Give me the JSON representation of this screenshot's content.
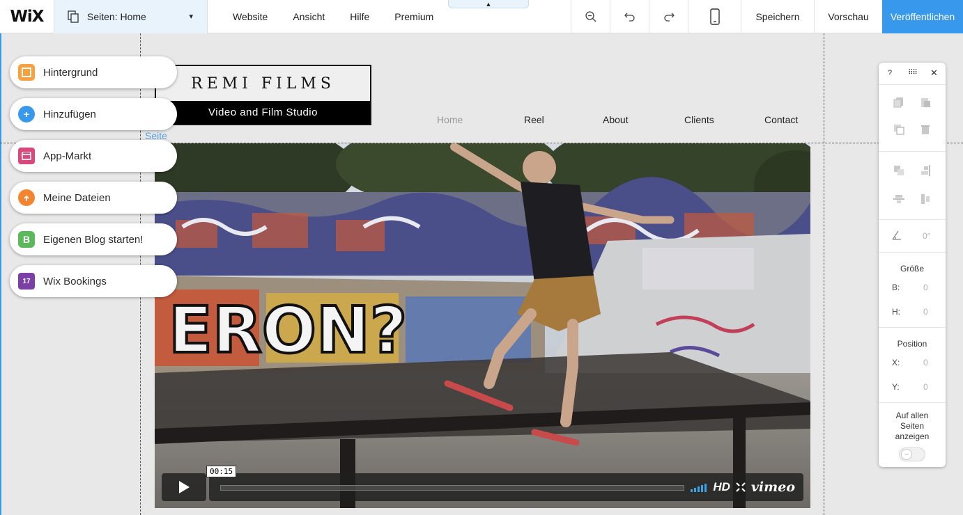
{
  "topbar": {
    "logo": "WiX",
    "pages_label": "Seiten: Home",
    "menu": [
      "Website",
      "Ansicht",
      "Hilfe",
      "Premium"
    ],
    "save_label": "Speichern",
    "preview_label": "Vorschau",
    "publish_label": "Veröffentlichen",
    "accent": "#3899ec"
  },
  "site": {
    "brand": "REMI FILMS",
    "tagline": "Video and Film Studio",
    "nav": [
      "Home",
      "Reel",
      "About",
      "Clients",
      "Contact"
    ],
    "active_nav": "Home",
    "page_label": "Seite"
  },
  "video": {
    "timecode": "00:15",
    "quality": "HD",
    "provider": "vimeo",
    "progress": 0.0
  },
  "left_tools": [
    {
      "label": "Hintergrund",
      "icon": "background-icon",
      "color": "#f7a03c"
    },
    {
      "label": "Hinzufügen",
      "icon": "add-icon",
      "color": "#3899ec"
    },
    {
      "label": "App-Markt",
      "icon": "app-market-icon",
      "color": "#d9487a"
    },
    {
      "label": "Meine Dateien",
      "icon": "upload-cloud-icon",
      "color": "#f58430"
    },
    {
      "label": "Eigenen Blog starten!",
      "icon": "blog-icon",
      "color": "#5cb85c"
    },
    {
      "label": "Wix Bookings",
      "icon": "calendar-icon",
      "color": "#7b3fa6"
    }
  ],
  "right_panel": {
    "help": "?",
    "rotation": "0°",
    "size_title": "Größe",
    "w_label": "B:",
    "w_value": "0",
    "h_label": "H:",
    "h_value": "0",
    "position_title": "Position",
    "x_label": "X:",
    "x_value": "0",
    "y_label": "Y:",
    "y_value": "0",
    "show_all_l1": "Auf allen",
    "show_all_l2": "Seiten",
    "show_all_l3": "anzeigen"
  }
}
